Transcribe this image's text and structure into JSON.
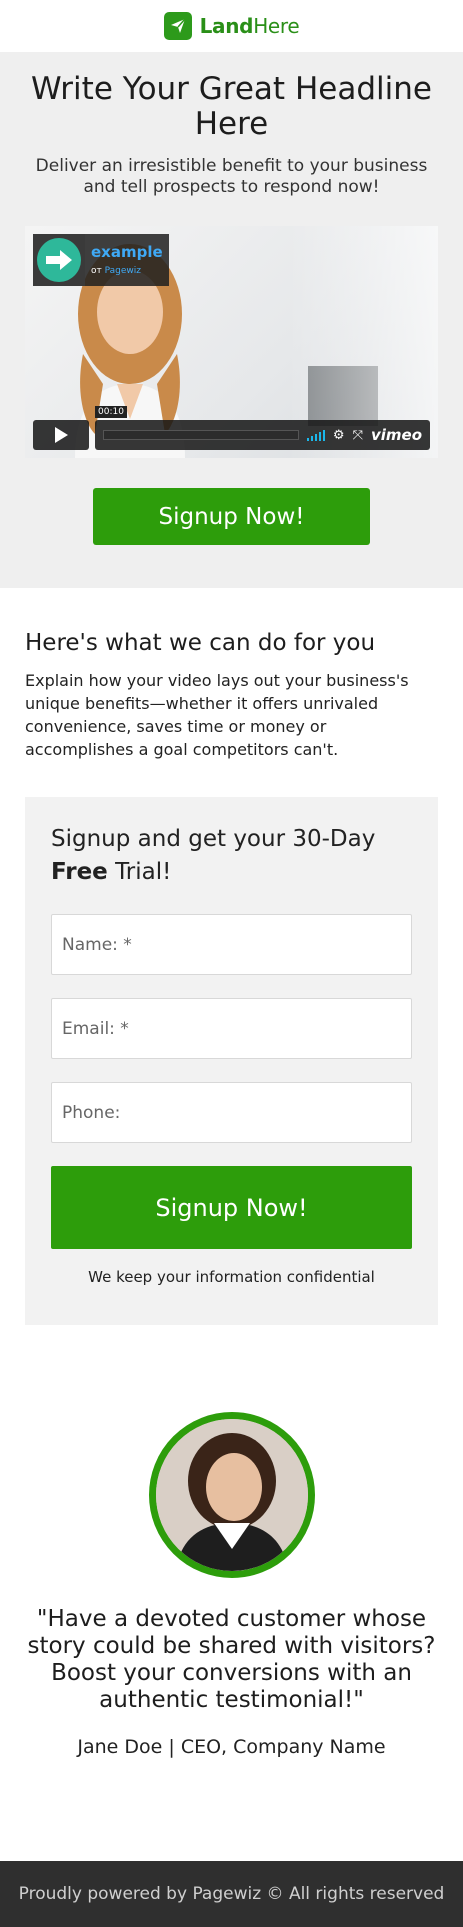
{
  "header": {
    "brand_bold": "Land",
    "brand_thin": "Here"
  },
  "hero": {
    "headline": "Write Your Great Headline Here",
    "subheadline": "Deliver an irresistible benefit to your business and tell prospects to respond now!",
    "video": {
      "badge_title": "example",
      "badge_by": "от",
      "badge_brand": "Pagewiz",
      "timecode": "00:10",
      "player_brand": "vimeo"
    },
    "cta_label": "Signup Now!"
  },
  "about": {
    "title": "Here's what we can do for you",
    "body": "Explain how your video lays out your business's unique benefits—whether it offers unrivaled convenience, saves time or money or accomplishes a goal competitors can't."
  },
  "form": {
    "title_start": "Signup and get your 30-Day",
    "title_bold": "Free",
    "title_end": "Trial!",
    "name_placeholder": "Name: *",
    "email_placeholder": "Email: *",
    "phone_placeholder": "Phone:",
    "submit_label": "Signup Now!",
    "note": "We keep your information confidential"
  },
  "testimonial": {
    "quote": "\"Have a devoted customer whose story could be shared with visitors? Boost your conversions with an authentic testimonial!\"",
    "author": "Jane Doe | CEO, Company Name"
  },
  "footer": {
    "text": "Proudly powered by Pagewiz © All rights reserved"
  },
  "colors": {
    "brand_green": "#2d9d0b",
    "hero_bg": "#efefef",
    "footer_bg": "#2f2f2f",
    "vimeo_blue": "#1ab7ea"
  },
  "icons": [
    "logo-send-icon",
    "arrow-right-icon",
    "play-icon",
    "volume-icon",
    "settings-icon",
    "fullscreen-icon"
  ]
}
